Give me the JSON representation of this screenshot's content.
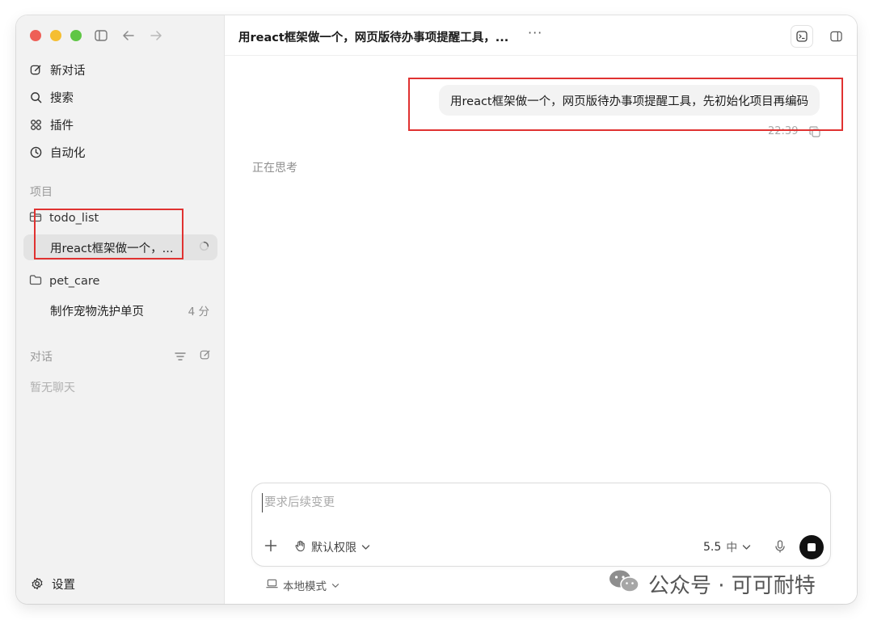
{
  "sidebar": {
    "nav": [
      {
        "label": "新对话",
        "icon": "edit-icon"
      },
      {
        "label": "搜索",
        "icon": "search-icon"
      },
      {
        "label": "插件",
        "icon": "plugins-icon"
      },
      {
        "label": "自动化",
        "icon": "clock-icon"
      }
    ],
    "projects_label": "项目",
    "projects": [
      {
        "name": "todo_list",
        "threads": [
          {
            "title": "用react框架做一个，...",
            "status": "loading-spinner"
          }
        ]
      },
      {
        "name": "pet_care",
        "threads": [
          {
            "title": "制作宠物洗护单页",
            "time": "4 分"
          }
        ]
      }
    ],
    "chats_label": "对话",
    "chats_empty": "暂无聊天",
    "settings_label": "设置"
  },
  "header": {
    "title": "用react框架做一个，网页版待办事项提醒工具，...",
    "more": "···"
  },
  "conversation": {
    "user_message": "用react框架做一个，网页版待办事项提醒工具，先初始化项目再编码",
    "time": "22:39",
    "status": "正在思考"
  },
  "composer": {
    "placeholder": "要求后续变更",
    "permission_label": "默认权限",
    "model_version": "5.5",
    "reasoning_level": "中"
  },
  "footer": {
    "mode_label": "本地模式"
  },
  "watermark": {
    "text": "公众号 · 可可耐特"
  },
  "colors": {
    "highlight_box": "#e03231",
    "sidebar_bg": "#f2f2f2",
    "active_thread_bg": "#e3e3e3"
  }
}
